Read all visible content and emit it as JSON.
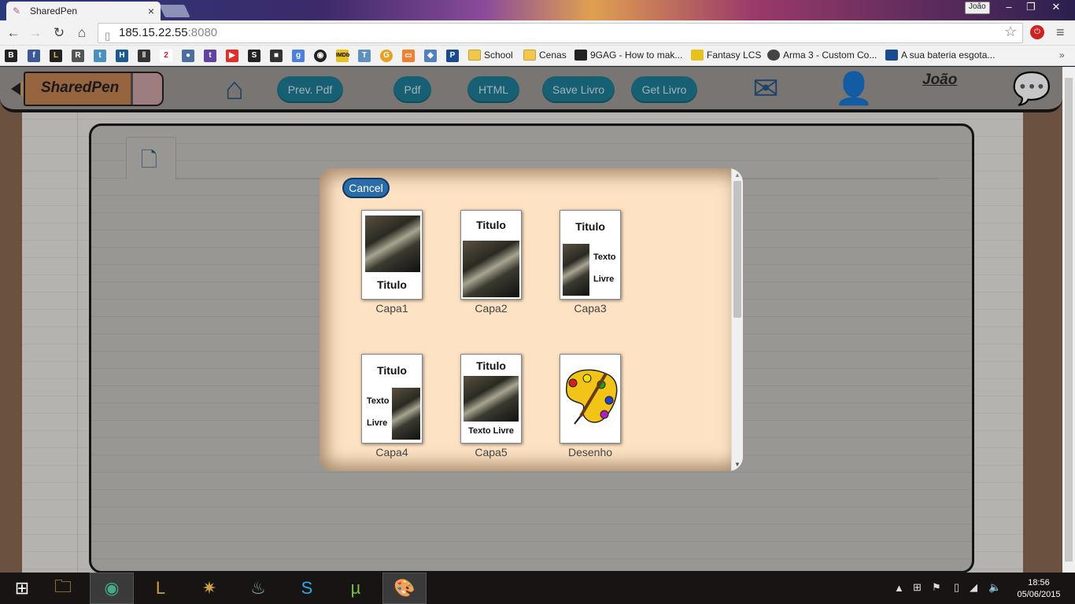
{
  "browser": {
    "tab_title": "SharedPen",
    "user_chip": "João",
    "url_host": "185.15.22.55",
    "url_port": ":8080",
    "bookmarks": [
      {
        "label": "School",
        "icon": "folder-icon"
      },
      {
        "label": "Cenas",
        "icon": "folder-icon"
      },
      {
        "label": "9GAG - How to mak...",
        "icon": "9gag-icon"
      },
      {
        "label": "Fantasy LCS",
        "icon": "fantasy-icon"
      },
      {
        "label": "Arma 3 - Custom Co...",
        "icon": "biohazard-icon"
      },
      {
        "label": "A sua bateria esgota...",
        "icon": "p-icon"
      }
    ]
  },
  "app": {
    "logo": "SharedPen",
    "buttons": {
      "prev_pdf": "Prev. Pdf",
      "pdf": "Pdf",
      "html": "HTML",
      "save": "Save Livro",
      "get": "Get Livro"
    },
    "user_name": "João"
  },
  "modal": {
    "cancel_label": "Cancel",
    "templates": [
      {
        "caption": "Capa1",
        "title": "Titulo"
      },
      {
        "caption": "Capa2",
        "title": "Titulo"
      },
      {
        "caption": "Capa3",
        "title": "Titulo",
        "text1": "Texto",
        "text2": "Livre"
      },
      {
        "caption": "Capa4",
        "title": "Titulo",
        "text1": "Texto",
        "text2": "Livre"
      },
      {
        "caption": "Capa5",
        "title": "Titulo",
        "text": "Texto Livre"
      },
      {
        "caption": "Desenho"
      }
    ]
  },
  "taskbar": {
    "time": "18:56",
    "date": "05/06/2015"
  }
}
